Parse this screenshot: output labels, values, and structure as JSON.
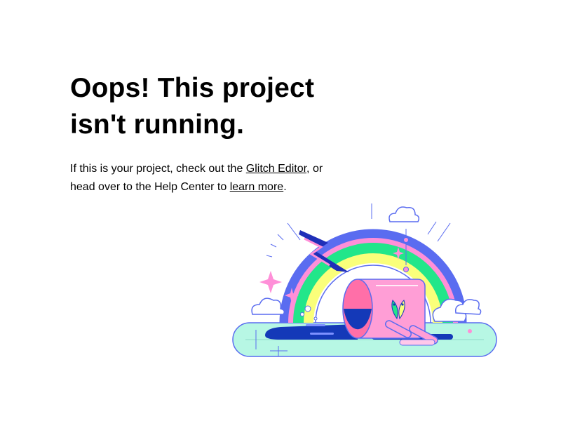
{
  "heading": {
    "line1": "Oops! This project",
    "line2": "isn't running."
  },
  "message": {
    "part1": "If this is your project, check out the ",
    "glitch_editor_link": "Glitch Editor",
    "part2": ", or head over to the Help Center to ",
    "learn_more_link": "learn more",
    "part3": "."
  },
  "illustration": {
    "icon": "rainbow-fish-can-illustration",
    "colors": {
      "rainbow_outer": "#5a6cf0",
      "rainbow_pink": "#ff8fd8",
      "rainbow_green": "#22e68a",
      "rainbow_yellow": "#faff7a",
      "water": "#b7f7e4",
      "puddle": "#1439b8",
      "can": "#ff9ed6",
      "bolt": "#1f2fb8"
    }
  }
}
